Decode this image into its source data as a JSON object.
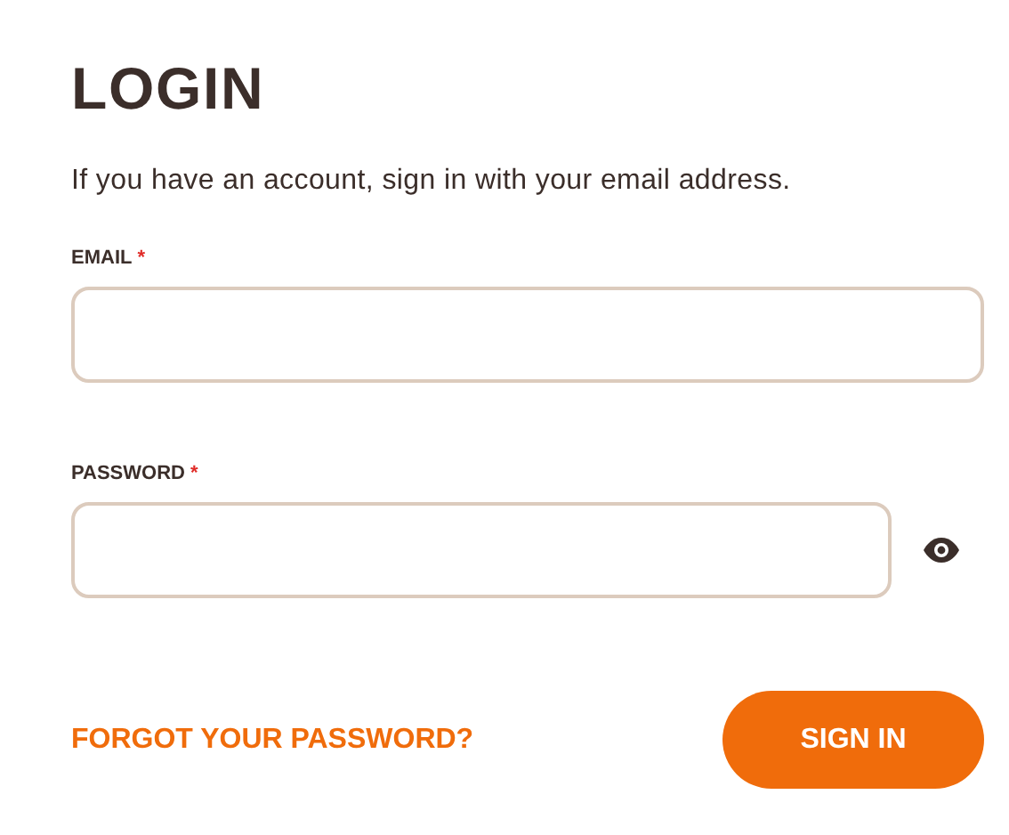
{
  "title": "LOGIN",
  "intro": "If you have an account, sign in with your email address.",
  "fields": [
    {
      "kind": "text",
      "label": "EMAIL",
      "required_mark": "*"
    },
    {
      "kind": "password",
      "label": "PASSWORD",
      "required_mark": "*"
    }
  ],
  "forgot_link": "FORGOT YOUR PASSWORD?",
  "submit_button": "SIGN IN"
}
